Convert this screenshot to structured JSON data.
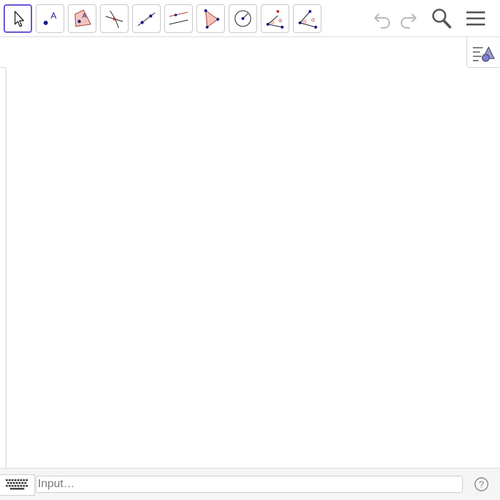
{
  "toolbar": {
    "tools": [
      {
        "id": "move",
        "icon": "move-arrow-icon",
        "active": true
      },
      {
        "id": "point",
        "icon": "point-icon",
        "label": "A"
      },
      {
        "id": "point-on-object",
        "icon": "point-on-object-icon",
        "label": "A"
      },
      {
        "id": "intersect",
        "icon": "intersect-icon"
      },
      {
        "id": "line",
        "icon": "line-through-two-points-icon"
      },
      {
        "id": "parallel-line",
        "icon": "parallel-line-icon"
      },
      {
        "id": "polygon",
        "icon": "polygon-icon"
      },
      {
        "id": "circle",
        "icon": "circle-with-center-icon"
      },
      {
        "id": "angle",
        "icon": "angle-icon",
        "label": "α"
      },
      {
        "id": "angle-given-size",
        "icon": "angle-given-size-icon",
        "label": "α"
      }
    ],
    "actions": [
      {
        "id": "undo",
        "icon": "undo-icon"
      },
      {
        "id": "redo",
        "icon": "redo-icon"
      },
      {
        "id": "search",
        "icon": "search-icon"
      },
      {
        "id": "menu",
        "icon": "hamburger-menu-icon"
      }
    ]
  },
  "input_bar": {
    "placeholder": "Input…",
    "value": ""
  },
  "colors": {
    "accent": "#6557d2",
    "point_blue": "#1a1a8c",
    "polygon_fill": "#f4c4bb",
    "polygon_stroke": "#9c4a3f",
    "red_accent": "#c0392b"
  }
}
